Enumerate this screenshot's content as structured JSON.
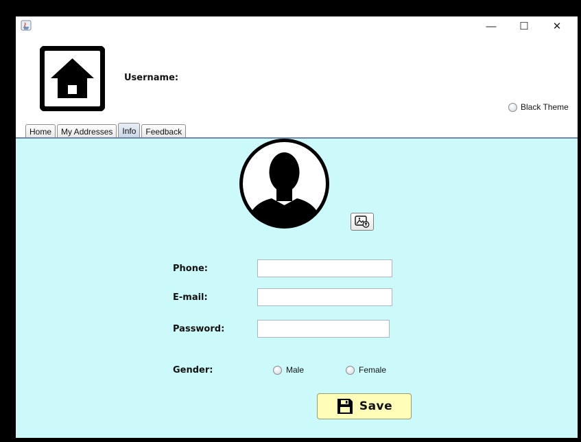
{
  "window": {
    "controls": {
      "minimize": "—",
      "maximize": "☐",
      "close": "✕"
    }
  },
  "header": {
    "username_label": "Username:",
    "logo_icon": "house-icon"
  },
  "theme": {
    "label": "Black Theme",
    "selected": false
  },
  "tabs": [
    {
      "label": "Home",
      "active": false
    },
    {
      "label": "My Addresses",
      "active": false
    },
    {
      "label": "Info",
      "active": true
    },
    {
      "label": "Feedback",
      "active": false
    }
  ],
  "profile": {
    "avatar_icon": "user-silhouette-icon",
    "change_photo_icon": "image-upload-icon"
  },
  "form": {
    "phone": {
      "label": "Phone:",
      "value": ""
    },
    "email": {
      "label": "E-mail:",
      "value": ""
    },
    "password": {
      "label": "Password:",
      "value": ""
    },
    "gender": {
      "label": "Gender:",
      "options": [
        "Male",
        "Female"
      ],
      "selected": null
    }
  },
  "save_button": {
    "label": "Save",
    "icon": "floppy-disk-icon"
  },
  "colors": {
    "content_bg": "#ccfafb",
    "save_bg": "#fffdb8",
    "frame": "#000000"
  }
}
